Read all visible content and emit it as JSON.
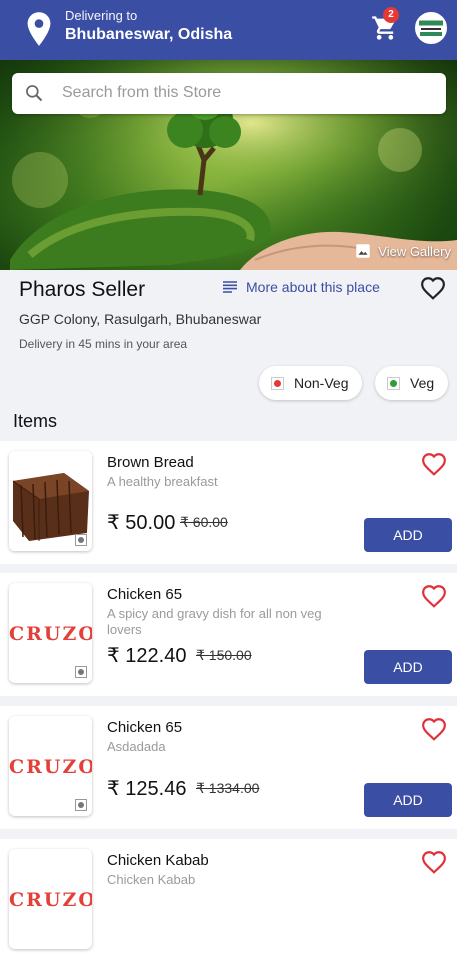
{
  "header": {
    "delivering_label": "Delivering to",
    "location": "Bhubaneswar, Odisha",
    "cart_count": "2",
    "brand_color": "#3a4ea3"
  },
  "search": {
    "placeholder": "Search from this Store"
  },
  "hero": {
    "view_gallery": "View Gallery"
  },
  "store": {
    "name": "Pharos Seller",
    "more_about": "More about this place",
    "address": "GGP Colony, Rasulgarh, Bhubaneswar",
    "delivery_time": "Delivery in 45 mins in your area"
  },
  "filters": [
    {
      "label": "Non-Veg",
      "color": "#e53935"
    },
    {
      "label": "Veg",
      "color": "#2e9e3a"
    }
  ],
  "items_heading": "Items",
  "items": [
    {
      "name": "Brown Bread",
      "desc": "A healthy breakfast",
      "price": "₹ 50.00",
      "old_price": "₹ 60.00",
      "add": "ADD",
      "image": "bread"
    },
    {
      "name": "Chicken 65",
      "desc": "A spicy and gravy dish for all non veg lovers",
      "price": "₹ 122.40",
      "old_price": "₹ 150.00",
      "add": "ADD",
      "image": "logo"
    },
    {
      "name": "Chicken 65",
      "desc": "Asdadada",
      "price": "₹ 125.46",
      "old_price": "₹ 1334.00",
      "add": "ADD",
      "image": "logo"
    },
    {
      "name": "Chicken Kabab",
      "desc": "Chicken Kabab",
      "price": "",
      "old_price": "",
      "add": "",
      "image": "logo"
    }
  ],
  "logo_text": "CRUZO"
}
